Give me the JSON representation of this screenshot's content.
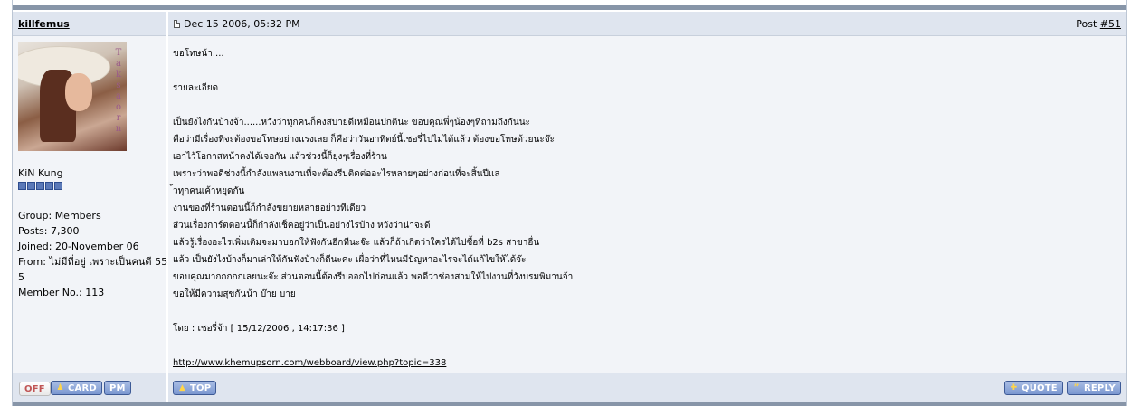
{
  "post": {
    "author": "killfemus",
    "date": "Dec 15 2006, 05:32 PM",
    "number_prefix": "Post ",
    "number": "#51"
  },
  "profile": {
    "avatar_watermark": "Taksaorn",
    "display_name": "KiN Kung",
    "rank_pips": 5,
    "group": "Group: Members",
    "posts": "Posts: 7,300",
    "joined": "Joined: 20-November 06",
    "from_line1": "From: ไม่มีที่อยู่ เพราะเป็นคนดี 555",
    "from_line2": "5",
    "member_no": "Member No.: 113"
  },
  "message": {
    "lines": [
      "ขอโทษน้า....",
      "",
      "รายละเอียด",
      "",
      "เป็นยังไงกันบ้างจ้า......หวังว่าทุกคนก็คงสบายดีเหมือนปกตินะ ขอบคุณพี่ๆน้องๆที่ถามถึงกันนะ",
      "คือว่ามีเรื่องที่จะต้องขอโทษอย่างแรงเลย ก็คือว่าวันอาทิตย์นี้เชอรี่ไปไม่ได้แล้ว ต้องขอโทษด้วยนะจ๊ะ",
      "เอาไว้โอกาสหน้าคงได้เจอกัน แล้วช่วงนี้ก็ยุ่งๆเรื่องที่ร้าน",
      "เพราะว่าพอดีช่วงนี้กำลังแพลนงานที่จะต้องรีบติดต่ออะไรหลายๆอย่างก่อนที่จะสิ้นปีแล",
      "้วทุกคนเค้าหยุดกัน",
      "งานของที่ร้านตอนนี้ก็กำลังขยายหลายอย่างทีเดียว",
      "ส่วนเรื่องการ์ตตอนนี้ก็กำลังเช็คอยู่ว่าเป็นอย่างไรบ้าง หวังว่าน่าจะดี",
      "แล้วรู้เรื่องอะไรเพิ่มเติมจะมาบอกให้ฟังกันอีกทีนะจ๊ะ แล้วก็ถ้าเกิดว่าใครได้ไปซื้อที่ b2s สาขาอื่น",
      "แล้ว เป็นยังไงบ้างก็มาเล่าให้กันฟังบ้างก็ดีนะคะ เผื่อว่าที่ไหนมีปัญหาอะไรจะได้แก้ไขให้ได้จ๊ะ",
      "ขอบคุณมากกกกกเลยนะจ๊ะ ส่วนตอนนี้ต้องรีบออกไปก่อนแล้ว พอดีว่าช่องสามให้ไปงานที่วังบรมพิมานจ้า",
      "ขอให้มีความสุขกันน้า บ๊าย บาย",
      "",
      "โดย : เชอรี่จ้า [ 15/12/2006 , 14:17:36 ]",
      "",
      "http://www.khemupsorn.com/webboard/view.php?topic=338"
    ]
  },
  "buttons": {
    "off": "OFF",
    "card": "CARD",
    "pm": "PM",
    "top": "TOP",
    "quote": "QUOTE",
    "reply": "REPLY"
  },
  "colors": {
    "header_bg": "#dfe5ef",
    "body_bg": "#f2f4f8",
    "bar": "#8795a8",
    "button_blue": "#7a97d0"
  }
}
